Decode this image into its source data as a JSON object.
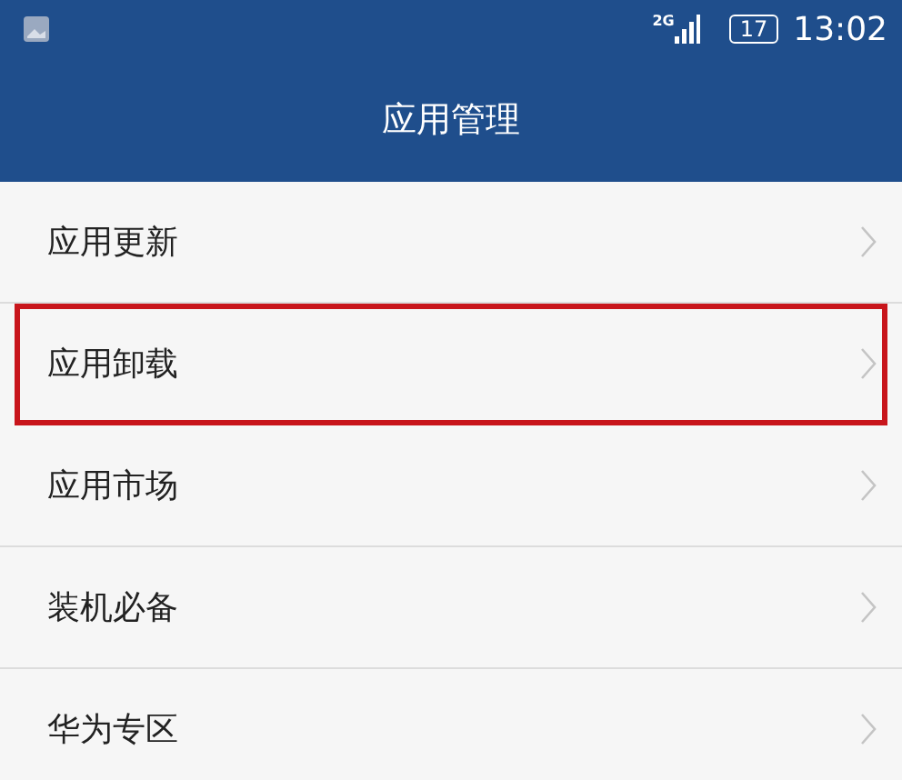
{
  "status_bar": {
    "network": "2G",
    "battery": "17",
    "time": "13:02"
  },
  "header": {
    "title": "应用管理"
  },
  "items": [
    {
      "label": "应用更新",
      "highlighted": false
    },
    {
      "label": "应用卸载",
      "highlighted": true
    },
    {
      "label": "应用市场",
      "highlighted": false
    },
    {
      "label": "装机必备",
      "highlighted": false
    },
    {
      "label": "华为专区",
      "highlighted": false
    }
  ]
}
